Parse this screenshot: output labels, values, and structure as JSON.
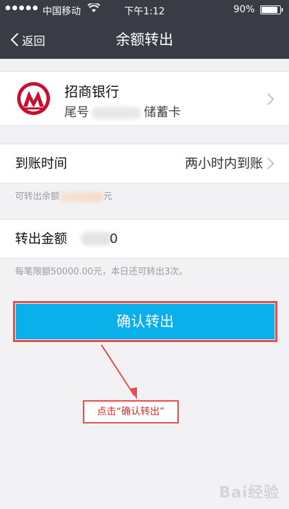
{
  "status_bar": {
    "carrier": "中国移动",
    "time": "下午1:12",
    "battery": "90%",
    "battery_level": 0.9
  },
  "nav": {
    "back_label": "返回",
    "title": "余额转出"
  },
  "bank": {
    "name": "招商银行",
    "card_prefix": "尾号",
    "card_type": "储蓄卡",
    "logo_color": "#c8102e"
  },
  "arrival": {
    "label": "到账时间",
    "value": "两小时内到账"
  },
  "available": {
    "label": "可转出余额",
    "suffix": "元"
  },
  "amount": {
    "label": "转出金额",
    "value": "0"
  },
  "limit_note": "每笔限额50000.00元，本日还可转出3次。",
  "confirm_button": "确认转出",
  "annotation": "点击“确认转出”",
  "watermark": "Bai经验",
  "colors": {
    "header_bg": "#393c44",
    "accent": "#0ab0ea",
    "highlight": "#e94a4a"
  }
}
